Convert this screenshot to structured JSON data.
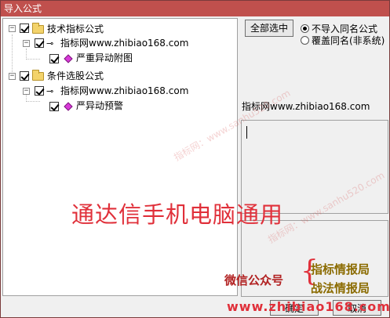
{
  "window": {
    "title": "导入公式"
  },
  "tree": {
    "nodes": [
      {
        "label": "技术指标公式"
      },
      {
        "label": "指标网www.zhibiao168.com"
      },
      {
        "label": "严重异动附图"
      },
      {
        "label": "条件选股公式"
      },
      {
        "label": "指标网www.zhibiao168.com"
      },
      {
        "label": "严异动预警"
      }
    ]
  },
  "controls": {
    "select_all_label": "全部选中",
    "options": [
      {
        "label": "不导入同名公式",
        "selected": true
      },
      {
        "label": "覆盖同名(非系统)",
        "selected": false
      }
    ]
  },
  "detail": {
    "name": "指标网www.zhibiao168.com"
  },
  "overlay": {
    "banner": "通达信手机电脑通用",
    "wechat_label": "微信公众号",
    "brand_1": "指标情报局",
    "brand_2": "战法情报局",
    "site": "www.zhibiao168.com",
    "watermark_1": "指标网：www.sanhu520.com",
    "watermark_2": "指标网：www.sanhu520.com"
  },
  "buttons": {
    "ok_label": "确定",
    "cancel_label": "取消"
  },
  "icons": [
    "expander-minus-icon",
    "checkbox-checked-icon",
    "folder-icon",
    "key-icon",
    "formula-gem-icon",
    "radio-icon"
  ],
  "colors": {
    "titlebar": "#c0504d",
    "banner": "#e0303a",
    "brand": "#8b6b00"
  }
}
